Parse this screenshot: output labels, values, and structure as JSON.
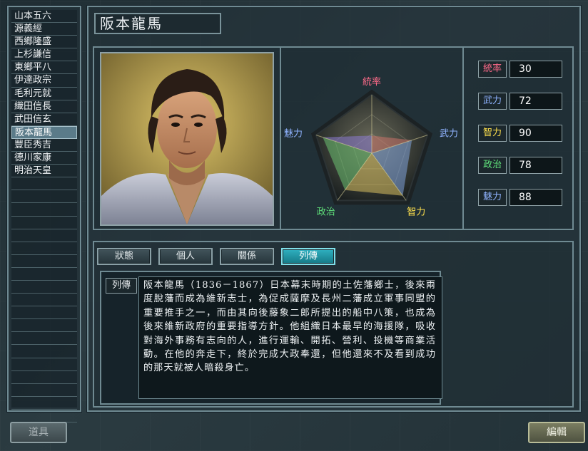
{
  "list": {
    "items": [
      "山本五六",
      "源義經",
      "西鄉隆盛",
      "上杉謙信",
      "東鄉平八",
      "伊達政宗",
      "毛利元就",
      "織田信長",
      "武田信玄",
      "阪本龍馬",
      "豐臣秀吉",
      "德川家康",
      "明治天皇",
      "",
      "",
      "",
      "",
      "",
      "",
      "",
      "",
      "",
      "",
      "",
      "",
      "",
      "",
      "",
      "",
      "",
      "",
      ""
    ],
    "selected_index": 9
  },
  "character": {
    "name": "阪本龍馬"
  },
  "radar": {
    "labels": {
      "leadership": "統率",
      "force": "武力",
      "intelligence": "智力",
      "politics": "政治",
      "charm": "魅力"
    },
    "label_colors": {
      "leadership": "#ff6b8a",
      "force": "#8fb3ff",
      "intelligence": "#ffe14d",
      "politics": "#5fe07a",
      "charm": "#8fb3ff"
    },
    "max": 100
  },
  "stats": [
    {
      "label": "統率",
      "value": "30",
      "color": "#ff6b8a"
    },
    {
      "label": "武力",
      "value": "72",
      "color": "#8fb3ff"
    },
    {
      "label": "智力",
      "value": "90",
      "color": "#ffe14d"
    },
    {
      "label": "政治",
      "value": "78",
      "color": "#5fe07a"
    },
    {
      "label": "魅力",
      "value": "88",
      "color": "#8fb3ff"
    }
  ],
  "tabs": [
    {
      "label": "狀態",
      "active": false
    },
    {
      "label": "個人",
      "active": false
    },
    {
      "label": "關係",
      "active": false
    },
    {
      "label": "列傳",
      "active": true
    }
  ],
  "bio": {
    "tag": "列傳",
    "text": "阪本龍馬（1836－1867）日本幕末時期的土佐藩鄉士，後來兩度脫藩而成為維新志士，為促成薩摩及長州二藩成立軍事同盟的重要推手之一，而由其向後藤象二郎所提出的船中八策，也成為後來維新政府的重要指導方針。他組織日本最早的海援隊，吸收對海外事務有志向的人，進行運輸、開拓、營利、投機等商業活動。在他的奔走下，終於完成大政奉還，但他還來不及看到成功的那天就被人暗殺身亡。"
  },
  "buttons": {
    "items": "道具",
    "edit": "編輯"
  }
}
